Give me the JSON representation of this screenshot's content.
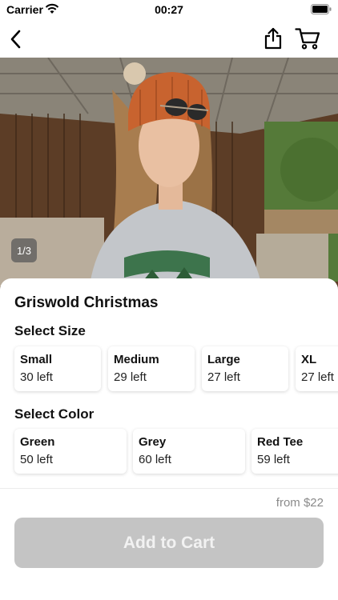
{
  "status_bar": {
    "carrier": "Carrier",
    "time": "00:27"
  },
  "nav": {
    "back_icon": "chevron-left-icon",
    "share_icon": "share-icon",
    "cart_icon": "cart-icon"
  },
  "product": {
    "image_indicator": "1/3",
    "title": "Griswold Christmas"
  },
  "size_section": {
    "label": "Select Size",
    "options": [
      {
        "name": "Small",
        "stock": "30 left"
      },
      {
        "name": "Medium",
        "stock": "29 left"
      },
      {
        "name": "Large",
        "stock": "27 left"
      },
      {
        "name": "XL",
        "stock": "27 left"
      }
    ]
  },
  "color_section": {
    "label": "Select Color",
    "options": [
      {
        "name": "Green",
        "stock": "50 left"
      },
      {
        "name": "Grey",
        "stock": "60 left"
      },
      {
        "name": "Red Tee",
        "stock": "59 left"
      }
    ]
  },
  "footer": {
    "price": "from $22",
    "add_to_cart": "Add to Cart"
  },
  "colors": {
    "button_disabled": "#c4c4c4",
    "price_text": "#8a8a8a"
  }
}
